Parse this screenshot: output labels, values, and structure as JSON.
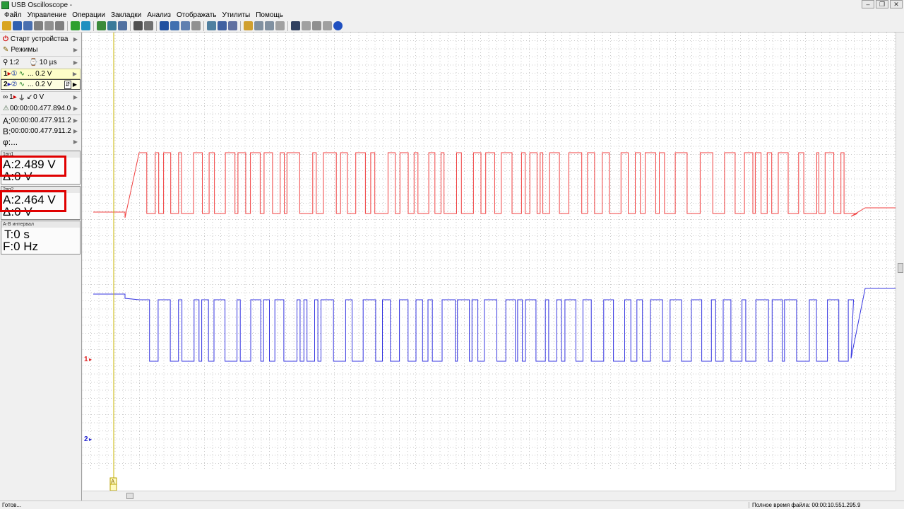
{
  "window": {
    "title": "USB Oscilloscope -",
    "controls": [
      "–",
      "❐",
      "✕"
    ]
  },
  "menu": [
    "Файл",
    "Управление",
    "Операции",
    "Закладки",
    "Анализ",
    "Отображать",
    "Утилиты",
    "Помощь"
  ],
  "left_panel": {
    "start_device": "Старт устройства",
    "modes": "Режимы",
    "zoom": "1:2",
    "timebase": "10 µs",
    "ch1_volts": "... 0.2 V",
    "ch2_volts": "... 0.2 V",
    "trigger": "1",
    "trigger_level": "0 V",
    "time_main": "00:00:00.477.894.0",
    "cursor_a_label": "A:",
    "cursor_a_time": "00:00:00.477.911.2",
    "cursor_b_label": "B:",
    "cursor_b_time": "00:00:00.477.911.2",
    "phi": "φ:...",
    "ch1": {
      "header": "1вп1",
      "a": "A:2.489 V",
      "d": "Δ:0 V"
    },
    "ch2": {
      "header": "2вп2",
      "a": "A:2.464 V",
      "d": "Δ:0 V"
    },
    "interval": {
      "header": "A-B интервал",
      "t": "T:0 s",
      "f": "F:0 Hz"
    }
  },
  "plot": {
    "ch1_marker": "1",
    "ch2_marker": "2",
    "cursor_letter": "A",
    "colors": {
      "ch1": "#f04040",
      "ch2": "#3535e0",
      "cursor": "#c8b400",
      "grid": "#c8c8c8"
    }
  },
  "status": {
    "left": "Готов...",
    "right": "Полное время файла: 00:00:10.551.295.9"
  }
}
